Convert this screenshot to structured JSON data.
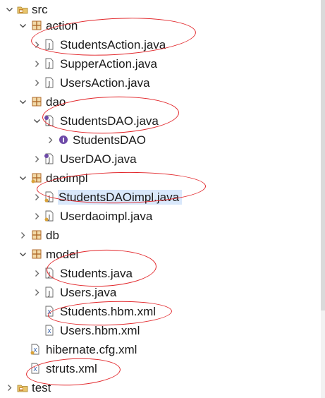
{
  "tree": {
    "items": [
      {
        "label": "src",
        "icon": "source-folder-icon",
        "expanded": true
      },
      {
        "label": "action",
        "icon": "package-icon",
        "expanded": true
      },
      {
        "label": "StudentsAction.java",
        "icon": "java-file-icon",
        "expanded": false
      },
      {
        "label": "SupperAction.java",
        "icon": "java-file-icon",
        "expanded": false
      },
      {
        "label": "UsersAction.java",
        "icon": "java-file-icon",
        "expanded": false
      },
      {
        "label": "dao",
        "icon": "package-icon",
        "expanded": true
      },
      {
        "label": "StudentsDAO.java",
        "icon": "java-interface-file-icon",
        "expanded": true
      },
      {
        "label": "StudentsDAO",
        "icon": "interface-icon",
        "expanded": false
      },
      {
        "label": "UserDAO.java",
        "icon": "java-interface-file-icon",
        "expanded": false
      },
      {
        "label": "daoimpl",
        "icon": "package-icon",
        "expanded": true
      },
      {
        "label": "StudentsDAOimpl.java",
        "icon": "java-file-icon",
        "expanded": false,
        "selected": true
      },
      {
        "label": "Userdaoimpl.java",
        "icon": "java-file-icon",
        "expanded": false
      },
      {
        "label": "db",
        "icon": "package-icon",
        "expanded": false
      },
      {
        "label": "model",
        "icon": "package-icon",
        "expanded": true
      },
      {
        "label": "Students.java",
        "icon": "java-file-icon",
        "expanded": false
      },
      {
        "label": "Users.java",
        "icon": "java-file-icon",
        "expanded": false
      },
      {
        "label": "Students.hbm.xml",
        "icon": "xml-file-icon"
      },
      {
        "label": "Users.hbm.xml",
        "icon": "xml-file-icon"
      },
      {
        "label": "hibernate.cfg.xml",
        "icon": "xml-file-icon"
      },
      {
        "label": "struts.xml",
        "icon": "xml-file-icon"
      },
      {
        "label": "test",
        "icon": "source-folder-icon",
        "expanded": false
      }
    ]
  },
  "colors": {
    "annotation": "#e2262a",
    "selection": "#d9e8fb",
    "package": "#b06a2a",
    "interface": "#6e4aa8"
  }
}
